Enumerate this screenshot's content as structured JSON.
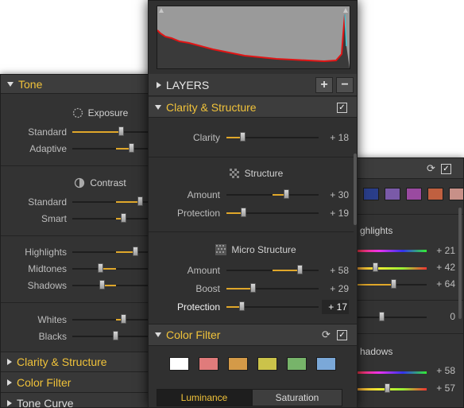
{
  "left_panel": {
    "tone_title": "Tone",
    "exposure_title": "Exposure",
    "standard_1": "Standard",
    "adaptive": "Adaptive",
    "contrast_title": "Contrast",
    "standard_2": "Standard",
    "smart": "Smart",
    "highlights": "Highlights",
    "midtones": "Midtones",
    "shadows": "Shadows",
    "whites": "Whites",
    "blacks": "Blacks",
    "clarity_title": "Clarity & Structure",
    "color_filter_title": "Color Filter",
    "tone_curve_title": "Tone Curve"
  },
  "center_panel": {
    "layers_title": "LAYERS",
    "add_btn": "+",
    "remove_btn": "−",
    "clarity_section": "Clarity & Structure",
    "clarity_label": "Clarity",
    "clarity_value": "+ 18",
    "structure_title": "Structure",
    "amount_label": "Amount",
    "amount_value": "+ 30",
    "protection_label": "Protection",
    "protection_value": "+ 19",
    "micro_title": "Micro Structure",
    "micro_amount_label": "Amount",
    "micro_amount_value": "+ 58",
    "boost_label": "Boost",
    "boost_value": "+ 29",
    "micro_protection_label": "Protection",
    "micro_protection_value": "+ 17",
    "color_filter_section": "Color Filter",
    "tab_luminance": "Luminance",
    "tab_saturation": "Saturation",
    "swatch_colors": [
      "#ffffff",
      "#e07b7b",
      "#d49a48",
      "#cbc34a",
      "#77b46a",
      "#7ba8d8"
    ]
  },
  "right_panel": {
    "highlights_partial": "ghlights",
    "val1": "+ 21",
    "val2": "+ 42",
    "val3": "+ 64",
    "val4": "0",
    "shadows_partial": "hadows",
    "val5": "+ 58",
    "val6": "+ 57",
    "swatch_colors": [
      "#2a3e8a",
      "#7a5aa8",
      "#9a4aa0",
      "#c06040",
      "#c89088"
    ]
  },
  "slider_levels": {
    "standard_1": 0.62,
    "adaptive": 0.68,
    "standard_2": 0.83,
    "smart": 0.58,
    "highlights": 0.74,
    "midtones": 0.32,
    "shadows": 0.34,
    "whites": 0.58,
    "blacks": 0.52,
    "clarity": 0.18,
    "amount": 0.6,
    "protection": 0.19,
    "micro_amount": 0.79,
    "boost": 0.29,
    "micro_protection": 0.17
  }
}
